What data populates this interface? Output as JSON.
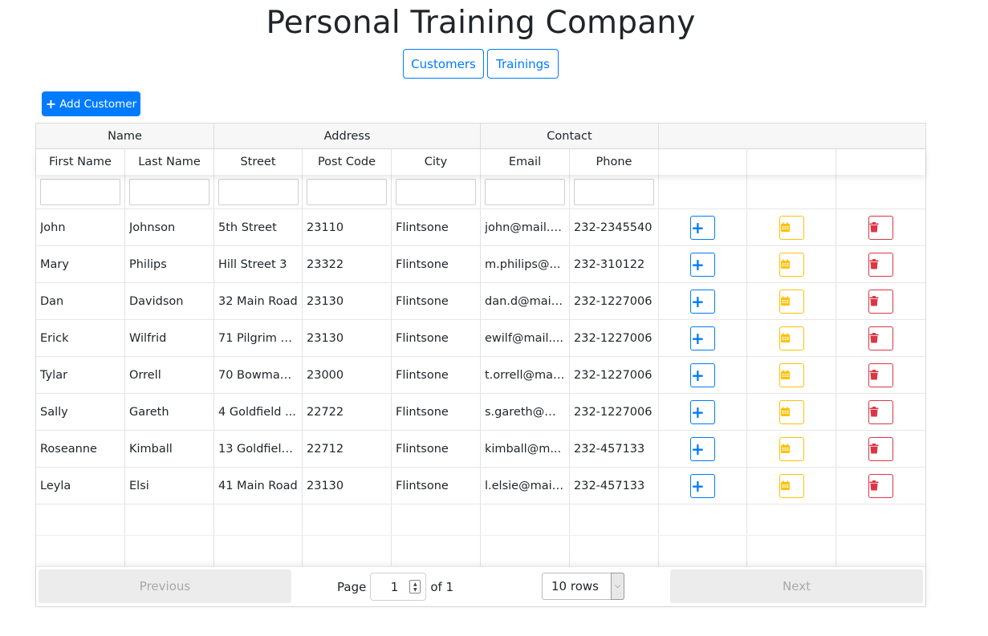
{
  "page": {
    "title": "Personal Training Company"
  },
  "nav": {
    "customers": "Customers",
    "trainings": "Trainings"
  },
  "toolbar": {
    "add_customer": "Add Customer"
  },
  "table": {
    "groups": {
      "name": "Name",
      "address": "Address",
      "contact": "Contact"
    },
    "columns": {
      "first_name": "First Name",
      "last_name": "Last Name",
      "street": "Street",
      "post_code": "Post Code",
      "city": "City",
      "email": "Email",
      "phone": "Phone"
    },
    "rows": [
      {
        "first": "John",
        "last": "Johnson",
        "street": "5th Street",
        "post": "23110",
        "city": "Flintsone",
        "email": "john@mail.c...",
        "phone": "232-2345540"
      },
      {
        "first": "Mary",
        "last": "Philips",
        "street": "Hill Street 3",
        "post": "23322",
        "city": "Flintsone",
        "email": "m.philips@...",
        "phone": "232-310122"
      },
      {
        "first": "Dan",
        "last": "Davidson",
        "street": "32 Main Road",
        "post": "23130",
        "city": "Flintsone",
        "email": "dan.d@mail....",
        "phone": "232-1227006"
      },
      {
        "first": "Erick",
        "last": "Wilfrid",
        "street": "71 Pilgrim A...",
        "post": "23130",
        "city": "Flintsone",
        "email": "ewilf@mail....",
        "phone": "232-1227006"
      },
      {
        "first": "Tylar",
        "last": "Orrell",
        "street": "70 Bowman ...",
        "post": "23000",
        "city": "Flintsone",
        "email": "t.orrell@mai...",
        "phone": "232-1227006"
      },
      {
        "first": "Sally",
        "last": "Gareth",
        "street": "4 Goldfield ...",
        "post": "22722",
        "city": "Flintsone",
        "email": "s.gareth@m...",
        "phone": "232-1227006"
      },
      {
        "first": "Roseanne",
        "last": "Kimball",
        "street": "13 Goldfield...",
        "post": "22712",
        "city": "Flintsone",
        "email": "kimball@m...",
        "phone": "232-457133"
      },
      {
        "first": "Leyla",
        "last": "Elsi",
        "street": "41 Main Road",
        "post": "23130",
        "city": "Flintsone",
        "email": "l.elsie@mail....",
        "phone": "232-457133"
      }
    ]
  },
  "pagination": {
    "previous": "Previous",
    "next": "Next",
    "page_label": "Page",
    "page_value": "1",
    "of_label": "of 1",
    "rows_option": "10 rows"
  },
  "colors": {
    "primary": "#007bff",
    "warning": "#ffc107",
    "danger": "#dc3545"
  },
  "icons": {
    "add_customer": "plus-icon",
    "add_training": "plus-icon",
    "calendar": "calendar-icon",
    "delete": "trash-icon",
    "spinner": "spinner-arrows-icon",
    "select": "chevron-down-icon"
  }
}
